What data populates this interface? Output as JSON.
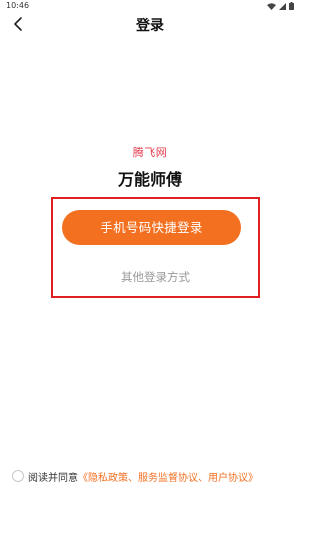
{
  "status_bar": {
    "time": "10:46"
  },
  "nav": {
    "title": "登录",
    "back_icon": "chevron-left-icon"
  },
  "brand": {
    "subtitle": "腾飞网",
    "title": "万能师傅"
  },
  "login": {
    "primary_button": "手机号码快捷登录",
    "other_login": "其他登录方式"
  },
  "agreement": {
    "prefix": "阅读并同意",
    "links": "《隐私政策、服务监督协议、用户协议》"
  },
  "colors": {
    "accent": "#f37021",
    "brand_red": "#e4394a",
    "highlight_border": "#e02020",
    "muted_text": "#999999"
  }
}
